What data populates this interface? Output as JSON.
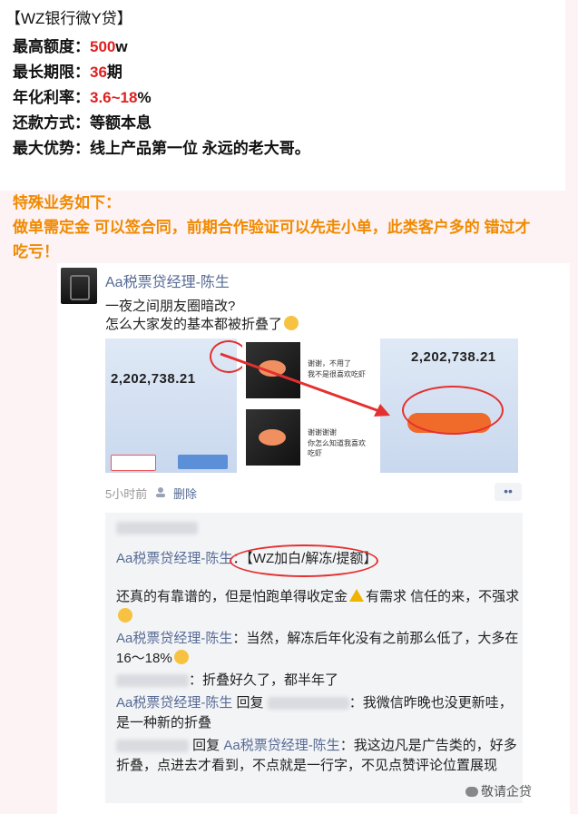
{
  "header": {
    "title": "【WZ银行微Y贷】",
    "rows": [
      {
        "label": "最高额度：",
        "value": "500",
        "suffix": "w"
      },
      {
        "label": "最长期限：",
        "value": "36",
        "suffix": "期"
      },
      {
        "label": "年化利率：",
        "value": "3.6~18",
        "suffix": "%"
      },
      {
        "label": "还款方式：",
        "value": "",
        "suffix": "等额本息"
      },
      {
        "label": "最大优势：",
        "value": "",
        "suffix": "线上产品第一位 永远的老大哥。"
      }
    ],
    "special_title": "特殊业务如下：",
    "special_line1": "做单需定金 可以签合同，前期合作验证可以先走小单，此类客户多的 错过才",
    "special_line2": "吃亏！"
  },
  "post": {
    "author": "Aa税票贷经理-陈生",
    "text_line1": "一夜之间朋友圈暗改?",
    "text_line2": "怎么大家发的基本都被折叠了",
    "image_amount_left": "2,202,738.21",
    "image_amount_right": "2,202,738.21",
    "chat_line1": "谢谢，不用了",
    "chat_line2": "我不是很喜欢吃虾",
    "chat_line3": "谢谢谢谢",
    "chat_line4": "你怎么知道我喜欢吃虾",
    "time": "5小时前",
    "delete": "删除",
    "more": "••"
  },
  "comments": [
    {
      "name": "Aa税票贷经理-陈生",
      "sep": "：",
      "text": "【WZ加白/解冻/提额】"
    },
    {
      "name": "",
      "sep": "",
      "text": "还真的有靠谱的，但是怕跑单得收定金",
      "text2": "有需求 信任的来，不强求"
    },
    {
      "name": "Aa税票贷经理-陈生",
      "sep": "：",
      "text": "当然，解冻后年化没有之前那么低了，大多在16～18%"
    },
    {
      "name": "",
      "sep": "：",
      "text": "折叠好久了，都半年了"
    },
    {
      "name": "Aa税票贷经理-陈生",
      "reply": " 回复 ",
      "sep": "：",
      "text": "我微信昨晚也没更新哇，是一种新的折叠"
    },
    {
      "name": "Aa税票贷经理-陈生",
      "reply": " 回复 ",
      "sep": "：",
      "text": "我这边凡是广告类的，好多折叠，点进去才看到，不点就是一行字，不见点赞评论位置展现"
    }
  ],
  "watermark": "敬请企贷",
  "colors": {
    "red": "#e02020",
    "orange": "#f08a00",
    "link": "#576b95"
  }
}
